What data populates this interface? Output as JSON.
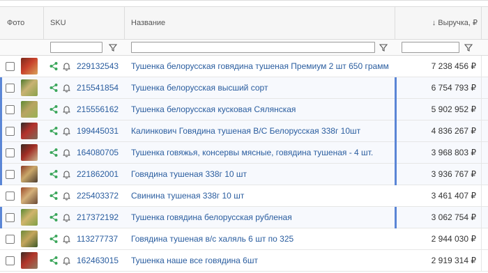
{
  "header": {
    "photo": "Фото",
    "sku": "SKU",
    "name": "Название",
    "revenue": "↓ Выручка, ₽"
  },
  "rows": [
    {
      "sku": "229132543",
      "name": "Тушенка белорусская говядина тушеная Премиум 2 шт 650 грамм",
      "revenue": "7 238 456 ₽",
      "highlight": false,
      "thumb": [
        "#7a2a1c",
        "#c8412b",
        "#d9a35a"
      ]
    },
    {
      "sku": "215541854",
      "name": "Тушенка белорусская высший сорт",
      "revenue": "6 754 793 ₽",
      "highlight": true,
      "thumb": [
        "#4f7a2e",
        "#c9b273",
        "#8aa24b"
      ]
    },
    {
      "sku": "215556162",
      "name": "Тушенка белорусская кусковая Сялянская",
      "revenue": "5 902 952 ₽",
      "highlight": true,
      "thumb": [
        "#5d8a34",
        "#b9a462",
        "#97b254"
      ]
    },
    {
      "sku": "199445031",
      "name": "Калинкович Говядина тушеная В/С Белорусская 338г 10шт",
      "revenue": "4 836 267 ₽",
      "highlight": true,
      "thumb": [
        "#2e2a28",
        "#b4312c",
        "#7d6b5a"
      ]
    },
    {
      "sku": "164080705",
      "name": "Тушенка говяжья, консервы мясные, говядина тушеная - 4 шт.",
      "revenue": "3 968 803 ₽",
      "highlight": true,
      "thumb": [
        "#3a2a22",
        "#a12d24",
        "#c9b28b"
      ]
    },
    {
      "sku": "221862001",
      "name": "Говядина тушеная 338г 10 шт",
      "revenue": "3 936 767 ₽",
      "highlight": true,
      "thumb": [
        "#8a3a26",
        "#caa86a",
        "#4d3d30"
      ]
    },
    {
      "sku": "225403372",
      "name": "Свинина тушеная 338г 10 шт",
      "revenue": "3 461 407 ₽",
      "highlight": false,
      "thumb": [
        "#9c4a2a",
        "#d4b07a",
        "#6b4a35"
      ]
    },
    {
      "sku": "217372192",
      "name": "Тушенка говядина белорусская рубленая",
      "revenue": "3 062 754 ₽",
      "highlight": true,
      "thumb": [
        "#5a8a34",
        "#d0b46c",
        "#7fa044"
      ]
    },
    {
      "sku": "113277737",
      "name": "Говядина тушеная в/с халяль 6 шт по 325",
      "revenue": "2 944 030 ₽",
      "highlight": false,
      "thumb": [
        "#6d8a3a",
        "#c4a55c",
        "#3d5a28"
      ]
    },
    {
      "sku": "162463015",
      "name": "Тушенка наше все говядина 6шт",
      "revenue": "2 919 314 ₽",
      "highlight": false,
      "thumb": [
        "#3b2b24",
        "#b2352a",
        "#8f7a60"
      ]
    }
  ],
  "colors": {
    "link": "#2a5d9f",
    "accent_marker": "#5b86d6",
    "share_icon": "#3aa65a"
  },
  "icons": [
    "share-icon",
    "bell-icon",
    "filter-icon"
  ]
}
